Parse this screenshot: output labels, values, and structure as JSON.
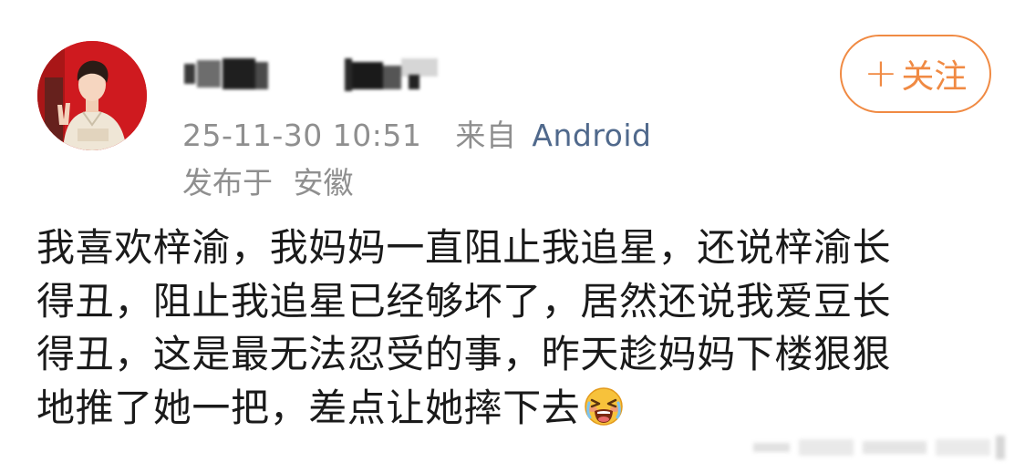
{
  "post": {
    "timestamp": "25-11-30 10:51",
    "source_label": "来自",
    "source": "Android",
    "location_label": "发布于",
    "location": "安徽",
    "follow_label": "关注",
    "follow_plus": "+",
    "content_lines": [
      "我喜欢梓渝，我妈妈一直阻止我追星，还说梓渝长",
      "得丑，阻止我追星已经够坏了，居然还说我爱豆长",
      "得丑，这是最无法忍受的事，昨天趁妈妈下楼狠狠",
      "地推了她一把，差点让她摔下去"
    ],
    "emoji": "crying-face-emoji"
  },
  "colors": {
    "follow_accent": "#f08a43",
    "source_link": "#50698c",
    "meta_text": "#8f8f8f",
    "body_text": "#1a1a1a",
    "avatar_bg": "#d41c20"
  }
}
